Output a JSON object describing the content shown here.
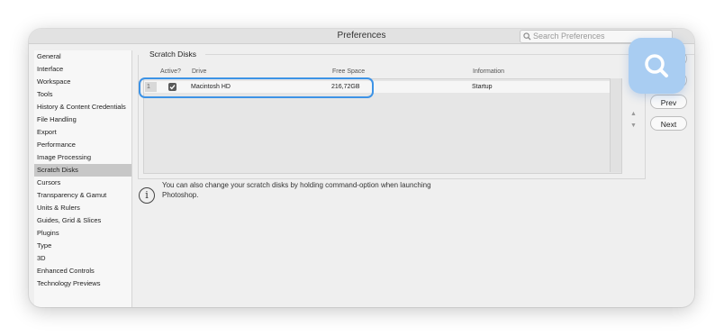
{
  "window": {
    "title": "Preferences",
    "search_placeholder": "Search Preferences"
  },
  "sidebar": {
    "items": [
      {
        "label": "General"
      },
      {
        "label": "Interface"
      },
      {
        "label": "Workspace"
      },
      {
        "label": "Tools"
      },
      {
        "label": "History & Content Credentials"
      },
      {
        "label": "File Handling"
      },
      {
        "label": "Export"
      },
      {
        "label": "Performance"
      },
      {
        "label": "Image Processing"
      },
      {
        "label": "Scratch Disks",
        "selected": true
      },
      {
        "label": "Cursors"
      },
      {
        "label": "Transparency & Gamut"
      },
      {
        "label": "Units & Rulers"
      },
      {
        "label": "Guides, Grid & Slices"
      },
      {
        "label": "Plugins"
      },
      {
        "label": "Type"
      },
      {
        "label": "3D"
      },
      {
        "label": "Enhanced Controls"
      },
      {
        "label": "Technology Previews"
      }
    ]
  },
  "scratch_disks": {
    "group_title": "Scratch Disks",
    "columns": {
      "active": "Active?",
      "drive": "Drive",
      "free_space": "Free Space",
      "information": "Information"
    },
    "rows": [
      {
        "number": "1",
        "active": true,
        "drive": "Macintosh HD",
        "free_space": "216,72GB",
        "information": "Startup"
      }
    ],
    "info_text": "You can also change your scratch disks by holding command-option when launching Photoshop."
  },
  "buttons": {
    "prev": "Prev",
    "next": "Next"
  },
  "arrows": {
    "up": "▲",
    "down": "▼"
  },
  "info_icon_glyph": "i",
  "colors": {
    "highlight": "#3d93e6",
    "magnifier_bg": "#a9cdf2",
    "selected_item": "#c7c7c7"
  }
}
